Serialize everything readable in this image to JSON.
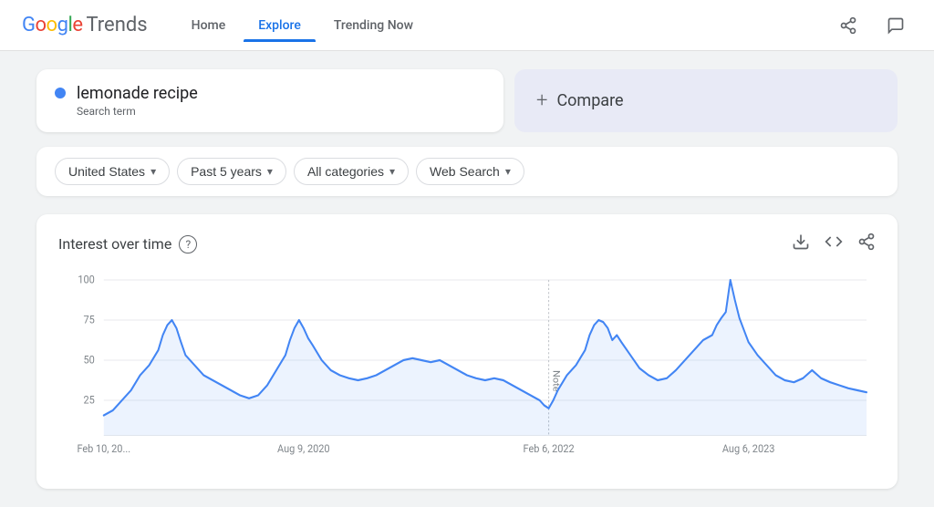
{
  "header": {
    "logo_google": "Google",
    "logo_trends": "Trends",
    "nav_items": [
      {
        "id": "home",
        "label": "Home",
        "active": false
      },
      {
        "id": "explore",
        "label": "Explore",
        "active": true
      },
      {
        "id": "trending",
        "label": "Trending Now",
        "active": false
      }
    ],
    "share_icon": "share",
    "feedback_icon": "feedback"
  },
  "search_area": {
    "search_term": "lemonade recipe",
    "search_type_label": "Search term",
    "compare_label": "Compare",
    "dot_color": "#4285f4"
  },
  "filters": {
    "region": {
      "label": "United States",
      "icon": "▾"
    },
    "period": {
      "label": "Past 5 years",
      "icon": "▾"
    },
    "category": {
      "label": "All categories",
      "icon": "▾"
    },
    "type": {
      "label": "Web Search",
      "icon": "▾"
    }
  },
  "chart": {
    "title": "Interest over time",
    "help_label": "?",
    "download_icon": "download",
    "embed_icon": "embed",
    "share_icon": "share",
    "y_labels": [
      "100",
      "75",
      "50",
      "25"
    ],
    "x_labels": [
      "Feb 10, 20...",
      "Aug 9, 2020",
      "Feb 6, 2022",
      "Aug 6, 2023"
    ],
    "note_label": "Note"
  }
}
